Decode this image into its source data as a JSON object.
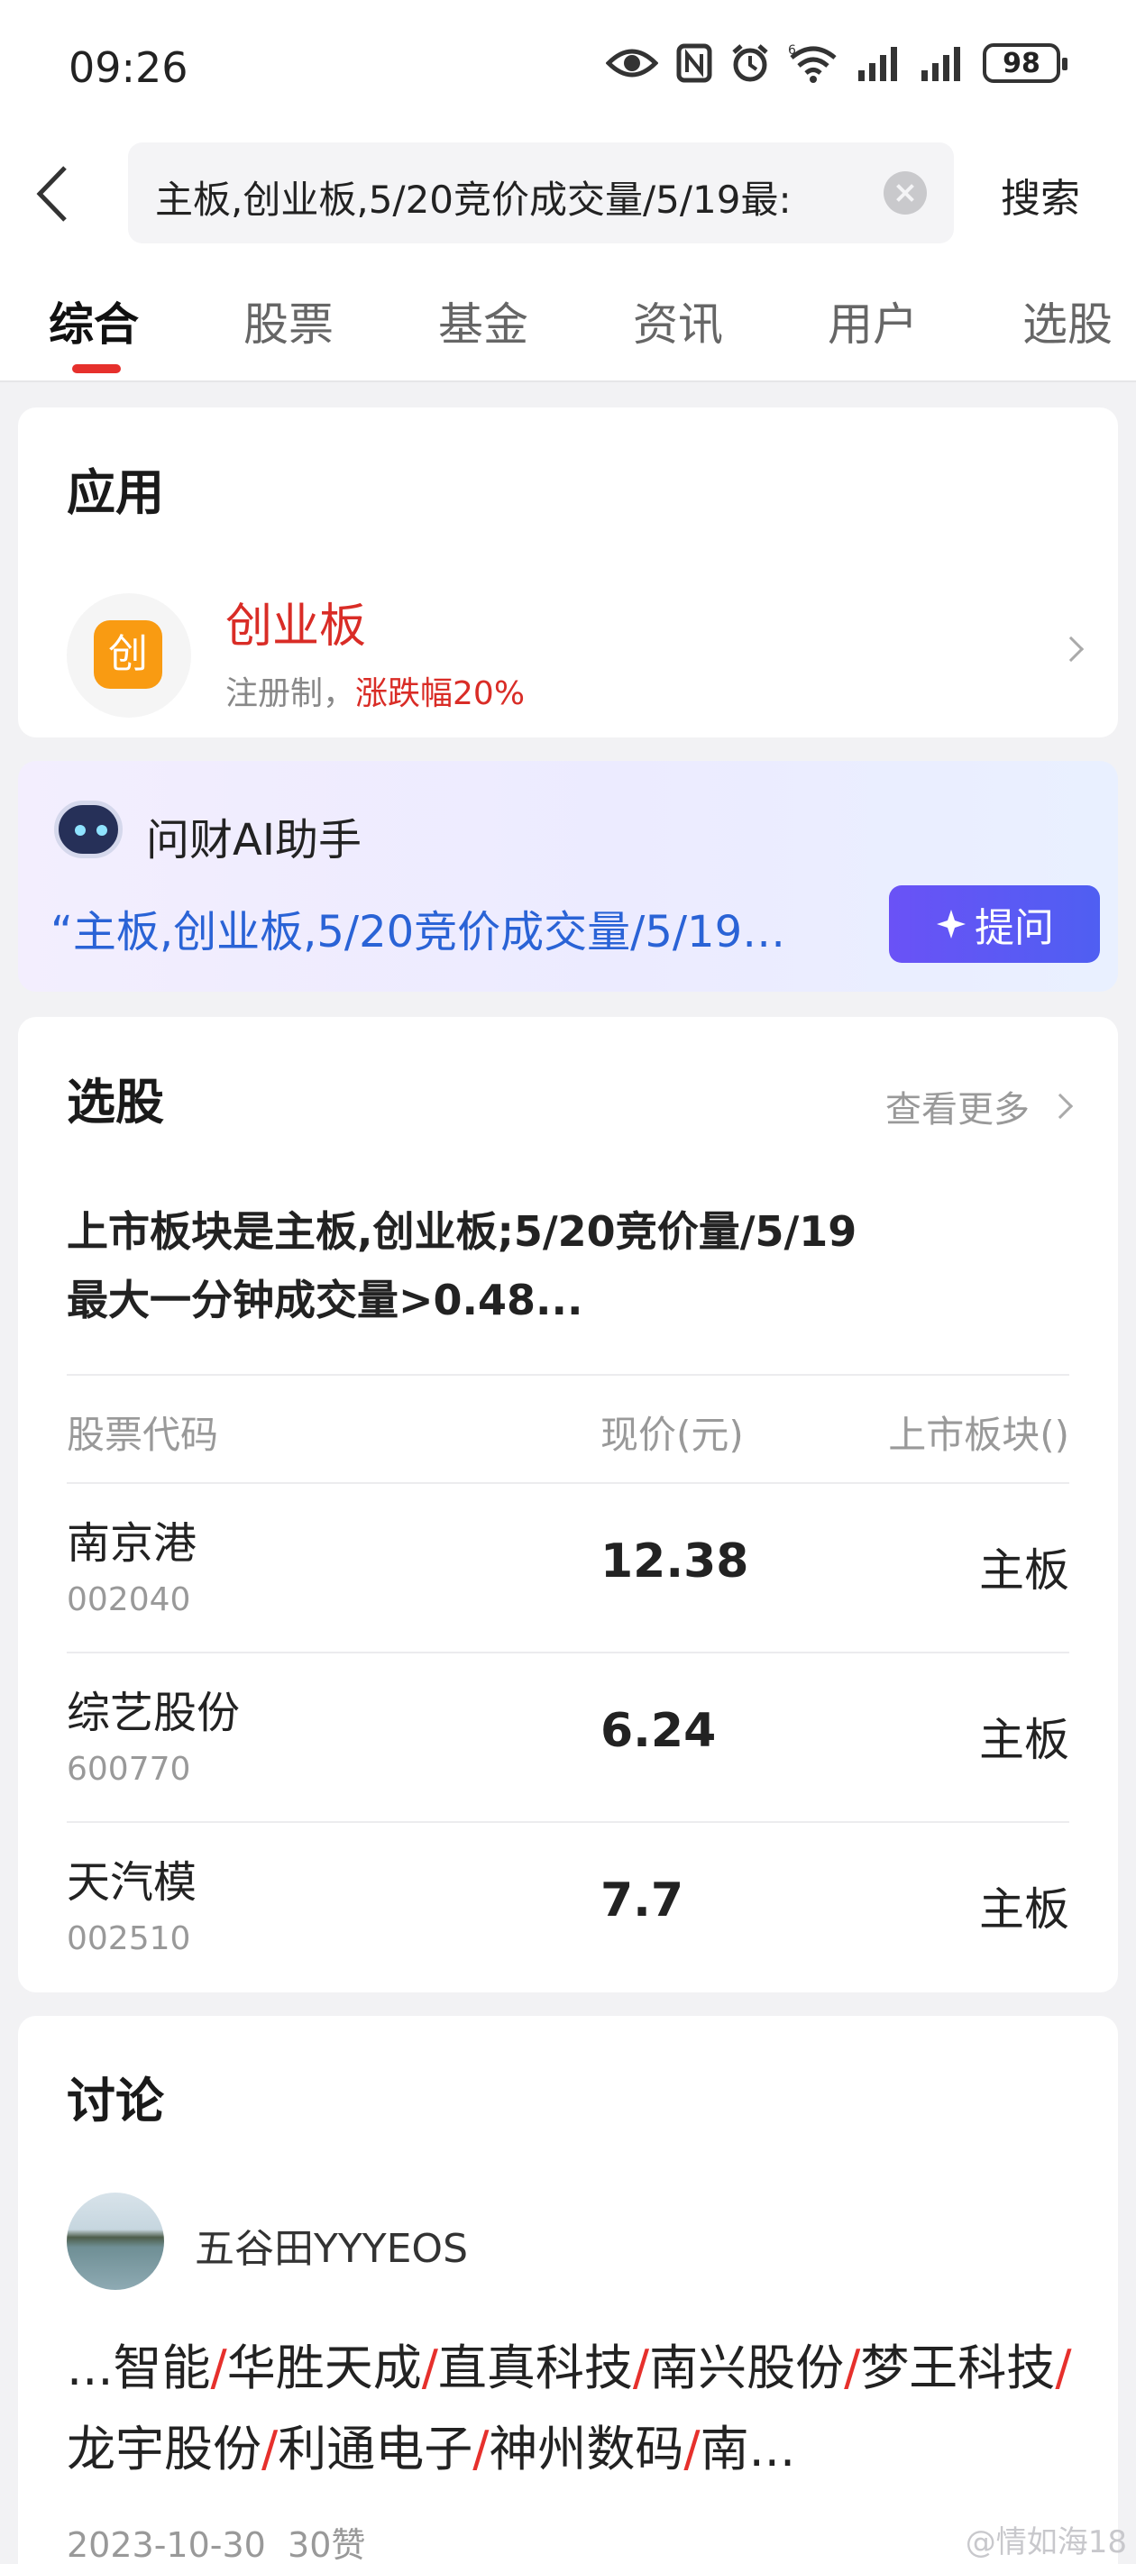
{
  "status_bar": {
    "time": "09:26",
    "battery": "98",
    "icons": [
      "eye-icon",
      "nfc-icon",
      "alarm-icon",
      "wifi-icon",
      "signal-icon",
      "signal-icon",
      "battery-icon"
    ]
  },
  "search": {
    "query": "主板,创业板,5/20竞价成交量/5/19最:",
    "button": "搜索"
  },
  "tabs": [
    "综合",
    "股票",
    "基金",
    "资讯",
    "用户",
    "选股"
  ],
  "active_tab": "综合",
  "apps": {
    "title": "应用",
    "item": {
      "icon_char": "创",
      "name": "创业板",
      "desc_prefix": "注册制，",
      "desc_highlight": "涨跌幅20%"
    }
  },
  "ai": {
    "title": "问财AI助手",
    "quote": "“主板,创业板,5/20竞价成交量/5/19…",
    "button": "提问"
  },
  "stock_pick": {
    "title": "选股",
    "more": "查看更多",
    "query": "上市板块是主板,创业板;5/20竞价量/5/19最大一分钟成交量>0.48...",
    "headers": [
      "股票代码",
      "现价(元)",
      "上市板块()"
    ],
    "rows": [
      {
        "name": "南京港",
        "code": "002040",
        "price": "12.38",
        "board": "主板"
      },
      {
        "name": "综艺股份",
        "code": "600770",
        "price": "6.24",
        "board": "主板"
      },
      {
        "name": "天汽模",
        "code": "002510",
        "price": "7.7",
        "board": "主板"
      }
    ]
  },
  "discussion": {
    "title": "讨论",
    "user": "五谷田YYYEOS",
    "post_prefix": "...",
    "post_items": [
      "智能",
      "华胜天成",
      "直真科技",
      "南兴股份",
      "梦王科技",
      "龙宇股份",
      "利通电子",
      "神州数码",
      "南..."
    ],
    "date": "2023-10-30",
    "likes": "30赞"
  },
  "watermark": "@情如海18",
  "colors": {
    "accent_red": "#e6302c",
    "ai_blue": "#2a63d6",
    "ai_button": "#5a58f4",
    "app_icon": "#f99b12"
  }
}
